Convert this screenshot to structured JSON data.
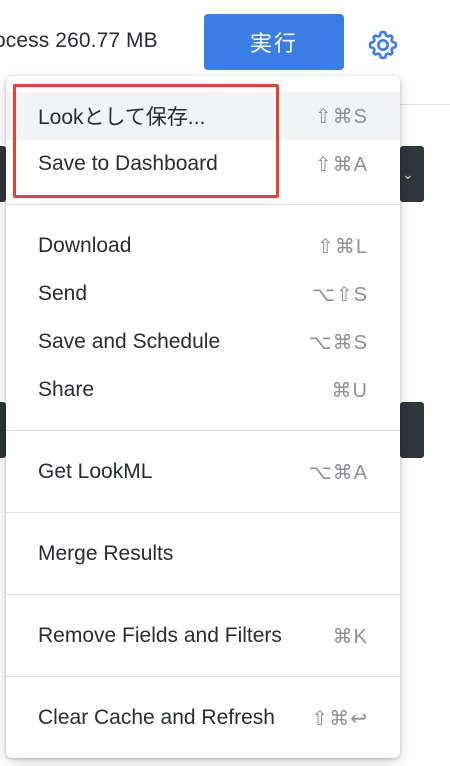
{
  "header": {
    "process_text": "ocess 260.77 MB",
    "run_button_label": "実行"
  },
  "menu": {
    "groups": [
      [
        {
          "label": "Lookとして保存...",
          "shortcut": "⇧⌘S"
        },
        {
          "label": "Save to Dashboard",
          "shortcut": "⇧⌘A"
        }
      ],
      [
        {
          "label": "Download",
          "shortcut": "⇧⌘L"
        },
        {
          "label": "Send",
          "shortcut": "⌥⇧S"
        },
        {
          "label": "Save and Schedule",
          "shortcut": "⌥⌘S"
        },
        {
          "label": "Share",
          "shortcut": "⌘U"
        }
      ],
      [
        {
          "label": "Get LookML",
          "shortcut": "⌥⌘A"
        }
      ],
      [
        {
          "label": "Merge Results",
          "shortcut": ""
        }
      ],
      [
        {
          "label": "Remove Fields and Filters",
          "shortcut": "⌘K"
        }
      ],
      [
        {
          "label": "Clear Cache and Refresh",
          "shortcut": "⇧⌘↩"
        }
      ]
    ]
  },
  "colors": {
    "accent": "#3a7de6",
    "highlight_border": "#e0462f",
    "text": "#262d33",
    "shortcut_text": "#8a9097"
  },
  "icons": {
    "settings": "gear-icon"
  }
}
